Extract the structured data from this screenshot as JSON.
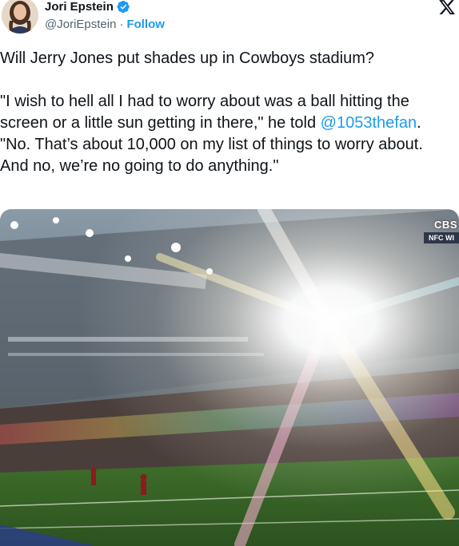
{
  "author": {
    "display_name": "Jori Epstein",
    "handle": "@JoriEpstein",
    "separator": "·",
    "follow_label": "Follow",
    "verified": true,
    "accent_color": "#1d9bf0"
  },
  "icons": {
    "verified": "verified-badge-icon",
    "brand": "x-logo-icon"
  },
  "tweet": {
    "line1": "Will Jerry Jones put shades up in Cowboys stadium?",
    "quote_part1": "\"I wish to hell all I had to worry about was a ball hitting the screen or a little sun getting in there,\" he told ",
    "mention": "@1053thefan",
    "quote_part2": ". \"No. That’s about 10,000 on my list of things to worry about. And no, we’re no going to do anything.\""
  },
  "media": {
    "broadcast_logo": "CBS",
    "broadcast_label": "NFC WI"
  }
}
